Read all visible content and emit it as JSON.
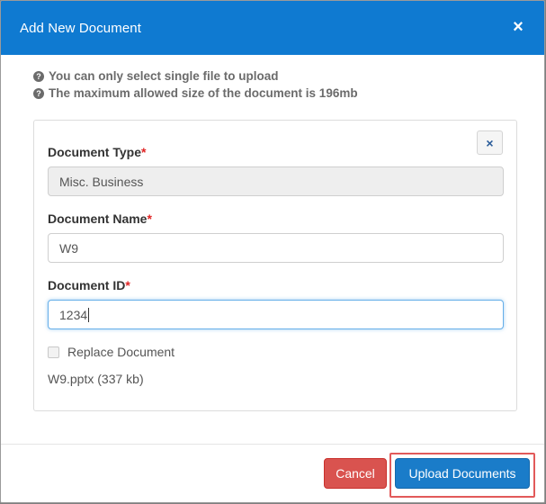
{
  "modal": {
    "title": "Add New Document",
    "close_glyph": "×"
  },
  "info": [
    {
      "icon": "question-circle-icon",
      "text": "You can only select single file to upload"
    },
    {
      "icon": "question-circle-icon",
      "text": "The maximum allowed size of the document is 196mb"
    }
  ],
  "form": {
    "remove_glyph": "×",
    "required_mark": "*",
    "document_type": {
      "label": "Document Type",
      "value": "Misc. Business"
    },
    "document_name": {
      "label": "Document Name",
      "value": "W9"
    },
    "document_id": {
      "label": "Document ID",
      "value": "1234"
    },
    "replace_document": {
      "label": "Replace Document",
      "checked": false
    },
    "file_info": "W9.pptx (337 kb)"
  },
  "footer": {
    "cancel_label": "Cancel",
    "upload_label": "Upload Documents"
  },
  "colors": {
    "header": "#0f7ad1",
    "cancel": "#d9534f",
    "upload": "#1a7cc9",
    "required": "#e02424",
    "highlight": "#e25a5a"
  }
}
